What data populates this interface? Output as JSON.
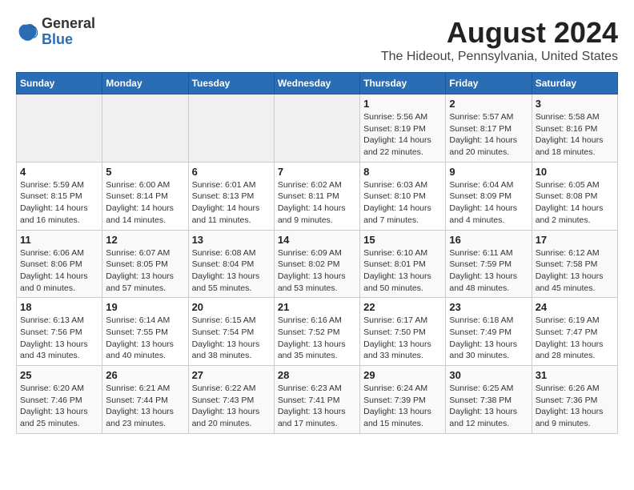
{
  "logo": {
    "general": "General",
    "blue": "Blue"
  },
  "title": {
    "month_year": "August 2024",
    "location": "The Hideout, Pennsylvania, United States"
  },
  "weekdays": [
    "Sunday",
    "Monday",
    "Tuesday",
    "Wednesday",
    "Thursday",
    "Friday",
    "Saturday"
  ],
  "weeks": [
    [
      {
        "day": "",
        "info": ""
      },
      {
        "day": "",
        "info": ""
      },
      {
        "day": "",
        "info": ""
      },
      {
        "day": "",
        "info": ""
      },
      {
        "day": "1",
        "info": "Sunrise: 5:56 AM\nSunset: 8:19 PM\nDaylight: 14 hours\nand 22 minutes."
      },
      {
        "day": "2",
        "info": "Sunrise: 5:57 AM\nSunset: 8:17 PM\nDaylight: 14 hours\nand 20 minutes."
      },
      {
        "day": "3",
        "info": "Sunrise: 5:58 AM\nSunset: 8:16 PM\nDaylight: 14 hours\nand 18 minutes."
      }
    ],
    [
      {
        "day": "4",
        "info": "Sunrise: 5:59 AM\nSunset: 8:15 PM\nDaylight: 14 hours\nand 16 minutes."
      },
      {
        "day": "5",
        "info": "Sunrise: 6:00 AM\nSunset: 8:14 PM\nDaylight: 14 hours\nand 14 minutes."
      },
      {
        "day": "6",
        "info": "Sunrise: 6:01 AM\nSunset: 8:13 PM\nDaylight: 14 hours\nand 11 minutes."
      },
      {
        "day": "7",
        "info": "Sunrise: 6:02 AM\nSunset: 8:11 PM\nDaylight: 14 hours\nand 9 minutes."
      },
      {
        "day": "8",
        "info": "Sunrise: 6:03 AM\nSunset: 8:10 PM\nDaylight: 14 hours\nand 7 minutes."
      },
      {
        "day": "9",
        "info": "Sunrise: 6:04 AM\nSunset: 8:09 PM\nDaylight: 14 hours\nand 4 minutes."
      },
      {
        "day": "10",
        "info": "Sunrise: 6:05 AM\nSunset: 8:08 PM\nDaylight: 14 hours\nand 2 minutes."
      }
    ],
    [
      {
        "day": "11",
        "info": "Sunrise: 6:06 AM\nSunset: 8:06 PM\nDaylight: 14 hours\nand 0 minutes."
      },
      {
        "day": "12",
        "info": "Sunrise: 6:07 AM\nSunset: 8:05 PM\nDaylight: 13 hours\nand 57 minutes."
      },
      {
        "day": "13",
        "info": "Sunrise: 6:08 AM\nSunset: 8:04 PM\nDaylight: 13 hours\nand 55 minutes."
      },
      {
        "day": "14",
        "info": "Sunrise: 6:09 AM\nSunset: 8:02 PM\nDaylight: 13 hours\nand 53 minutes."
      },
      {
        "day": "15",
        "info": "Sunrise: 6:10 AM\nSunset: 8:01 PM\nDaylight: 13 hours\nand 50 minutes."
      },
      {
        "day": "16",
        "info": "Sunrise: 6:11 AM\nSunset: 7:59 PM\nDaylight: 13 hours\nand 48 minutes."
      },
      {
        "day": "17",
        "info": "Sunrise: 6:12 AM\nSunset: 7:58 PM\nDaylight: 13 hours\nand 45 minutes."
      }
    ],
    [
      {
        "day": "18",
        "info": "Sunrise: 6:13 AM\nSunset: 7:56 PM\nDaylight: 13 hours\nand 43 minutes."
      },
      {
        "day": "19",
        "info": "Sunrise: 6:14 AM\nSunset: 7:55 PM\nDaylight: 13 hours\nand 40 minutes."
      },
      {
        "day": "20",
        "info": "Sunrise: 6:15 AM\nSunset: 7:54 PM\nDaylight: 13 hours\nand 38 minutes."
      },
      {
        "day": "21",
        "info": "Sunrise: 6:16 AM\nSunset: 7:52 PM\nDaylight: 13 hours\nand 35 minutes."
      },
      {
        "day": "22",
        "info": "Sunrise: 6:17 AM\nSunset: 7:50 PM\nDaylight: 13 hours\nand 33 minutes."
      },
      {
        "day": "23",
        "info": "Sunrise: 6:18 AM\nSunset: 7:49 PM\nDaylight: 13 hours\nand 30 minutes."
      },
      {
        "day": "24",
        "info": "Sunrise: 6:19 AM\nSunset: 7:47 PM\nDaylight: 13 hours\nand 28 minutes."
      }
    ],
    [
      {
        "day": "25",
        "info": "Sunrise: 6:20 AM\nSunset: 7:46 PM\nDaylight: 13 hours\nand 25 minutes."
      },
      {
        "day": "26",
        "info": "Sunrise: 6:21 AM\nSunset: 7:44 PM\nDaylight: 13 hours\nand 23 minutes."
      },
      {
        "day": "27",
        "info": "Sunrise: 6:22 AM\nSunset: 7:43 PM\nDaylight: 13 hours\nand 20 minutes."
      },
      {
        "day": "28",
        "info": "Sunrise: 6:23 AM\nSunset: 7:41 PM\nDaylight: 13 hours\nand 17 minutes."
      },
      {
        "day": "29",
        "info": "Sunrise: 6:24 AM\nSunset: 7:39 PM\nDaylight: 13 hours\nand 15 minutes."
      },
      {
        "day": "30",
        "info": "Sunrise: 6:25 AM\nSunset: 7:38 PM\nDaylight: 13 hours\nand 12 minutes."
      },
      {
        "day": "31",
        "info": "Sunrise: 6:26 AM\nSunset: 7:36 PM\nDaylight: 13 hours\nand 9 minutes."
      }
    ]
  ]
}
